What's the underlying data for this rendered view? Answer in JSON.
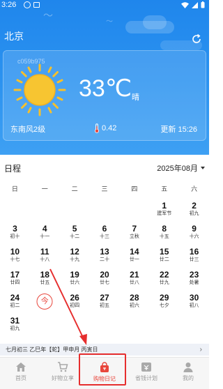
{
  "status_bar": {
    "time": "3:26"
  },
  "header": {
    "city": "北京",
    "watermark": "c059b975",
    "temperature": "33℃",
    "condition": "晴",
    "wind": "东南风2级",
    "humidity_value": "0.42",
    "update_time": "更新 15:26",
    "icons": {
      "refresh": "refresh-icon",
      "sun": "sun-icon",
      "thermometer": "thermometer-icon"
    }
  },
  "calendar": {
    "title": "日程",
    "month": "2025年08月",
    "weekdays": [
      "日",
      "一",
      "二",
      "三",
      "四",
      "五",
      "六"
    ],
    "days": [
      {
        "num": "",
        "lunar": ""
      },
      {
        "num": "",
        "lunar": ""
      },
      {
        "num": "",
        "lunar": ""
      },
      {
        "num": "",
        "lunar": ""
      },
      {
        "num": "",
        "lunar": ""
      },
      {
        "num": "1",
        "lunar": "建军节"
      },
      {
        "num": "2",
        "lunar": "初九"
      },
      {
        "num": "3",
        "lunar": "初十"
      },
      {
        "num": "4",
        "lunar": "十一"
      },
      {
        "num": "5",
        "lunar": "十二"
      },
      {
        "num": "6",
        "lunar": "十三"
      },
      {
        "num": "7",
        "lunar": "立秋"
      },
      {
        "num": "8",
        "lunar": "十五"
      },
      {
        "num": "9",
        "lunar": "十六"
      },
      {
        "num": "10",
        "lunar": "十七"
      },
      {
        "num": "11",
        "lunar": "十八"
      },
      {
        "num": "12",
        "lunar": "十九"
      },
      {
        "num": "13",
        "lunar": "二十"
      },
      {
        "num": "14",
        "lunar": "廿一"
      },
      {
        "num": "15",
        "lunar": "廿二"
      },
      {
        "num": "16",
        "lunar": "廿三"
      },
      {
        "num": "17",
        "lunar": "廿四"
      },
      {
        "num": "18",
        "lunar": "廿五"
      },
      {
        "num": "19",
        "lunar": "廿六"
      },
      {
        "num": "20",
        "lunar": "廿七"
      },
      {
        "num": "21",
        "lunar": "廿八"
      },
      {
        "num": "22",
        "lunar": "廿九"
      },
      {
        "num": "23",
        "lunar": "处暑"
      },
      {
        "num": "24",
        "lunar": "初二"
      },
      {
        "num": "今",
        "lunar": "",
        "today": true
      },
      {
        "num": "26",
        "lunar": "初四"
      },
      {
        "num": "27",
        "lunar": "初五"
      },
      {
        "num": "28",
        "lunar": "初六"
      },
      {
        "num": "29",
        "lunar": "七夕"
      },
      {
        "num": "30",
        "lunar": "初八"
      },
      {
        "num": "31",
        "lunar": "初九"
      }
    ],
    "info_bar": "七月初三 乙巳年【蛇】甲申月 丙寅日"
  },
  "nav": {
    "items": [
      {
        "label": "首页",
        "icon": "home-icon"
      },
      {
        "label": "好物立享",
        "icon": "cart-icon"
      },
      {
        "label": "购物日记",
        "icon": "shopping-bag-icon",
        "active": true
      },
      {
        "label": "省钱计划",
        "icon": "plan-icon"
      },
      {
        "label": "我的",
        "icon": "user-icon"
      }
    ]
  },
  "colors": {
    "header_blue": "#2c93f0",
    "accent_red": "#e8463c",
    "nav_gray": "#9a9a9a"
  }
}
